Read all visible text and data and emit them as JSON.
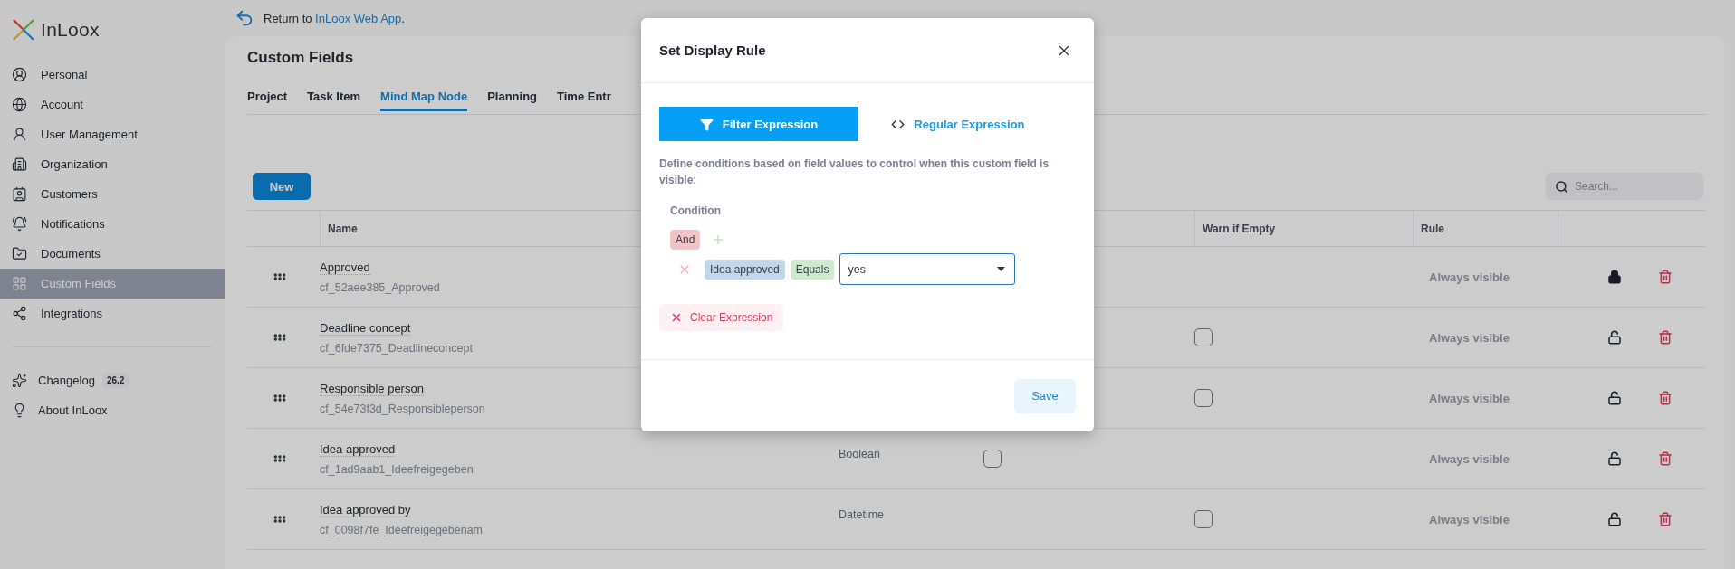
{
  "return_link": {
    "prefix": "Return to ",
    "link": "InLoox Web App",
    "suffix": "."
  },
  "sidebar": {
    "logo": "InLoox",
    "items": [
      {
        "label": "Personal",
        "selected": false
      },
      {
        "label": "Account",
        "selected": false
      },
      {
        "label": "User Management",
        "selected": false
      },
      {
        "label": "Organization",
        "selected": false
      },
      {
        "label": "Customers",
        "selected": false
      },
      {
        "label": "Notifications",
        "selected": false
      },
      {
        "label": "Documents",
        "selected": false
      },
      {
        "label": "Custom Fields",
        "selected": true
      },
      {
        "label": "Integrations",
        "selected": false
      }
    ],
    "footer": [
      {
        "label": "Changelog",
        "badge": "26.2"
      },
      {
        "label": "About InLoox"
      }
    ]
  },
  "page": {
    "title": "Custom Fields",
    "tabs": [
      {
        "label": "Project",
        "selected": false
      },
      {
        "label": "Task Item",
        "selected": false
      },
      {
        "label": "Mind Map Node",
        "selected": true
      },
      {
        "label": "Planning",
        "selected": false
      },
      {
        "label": "Time Entr",
        "selected": false
      }
    ],
    "new_button": "New",
    "search": {
      "placeholder": "Search..."
    }
  },
  "table": {
    "columns": {
      "name": "Name",
      "warn_if_empty": "Warn if Empty",
      "rule": "Rule"
    },
    "rows": [
      {
        "name": "Approved",
        "key": "cf_52aee385_Approved",
        "rule": "Always visible",
        "locked": true
      },
      {
        "name": "Deadline concept",
        "key": "cf_6fde7375_Deadlineconcept",
        "warn_if_empty": {
          "checked": false
        },
        "rule": "Always visible",
        "locked": false
      },
      {
        "name": "Responsible person",
        "key": "cf_54e73f3d_Responsibleperson",
        "warn_if_empty": {
          "checked": false
        },
        "rule": "Always visible",
        "locked": false
      },
      {
        "name": "Idea approved",
        "key": "cf_1ad9aab1_Ideefreigegeben",
        "type": "Boolean",
        "column_4": {
          "checked": false
        },
        "rule": "Always visible",
        "locked": false
      },
      {
        "name": "Idea approved by",
        "key": "cf_0098f7fe_Ideefreigegebenam",
        "type": "Datetime",
        "warn_if_empty": {
          "checked": false
        },
        "rule": "Always visible",
        "locked": false
      }
    ]
  },
  "dialog": {
    "title": "Set Display Rule",
    "modes": [
      {
        "label": "Filter Expression",
        "selected": true
      },
      {
        "label": "Regular Expression",
        "selected": false
      }
    ],
    "description": "Define conditions based on field values to control when this custom field is visible:",
    "condition_label": "Condition",
    "group": {
      "operator": "And",
      "conditions": [
        {
          "field": "Idea approved",
          "operator": "Equals",
          "value": "yes"
        }
      ]
    },
    "clear_button": "Clear Expression",
    "save_button": "Save"
  }
}
